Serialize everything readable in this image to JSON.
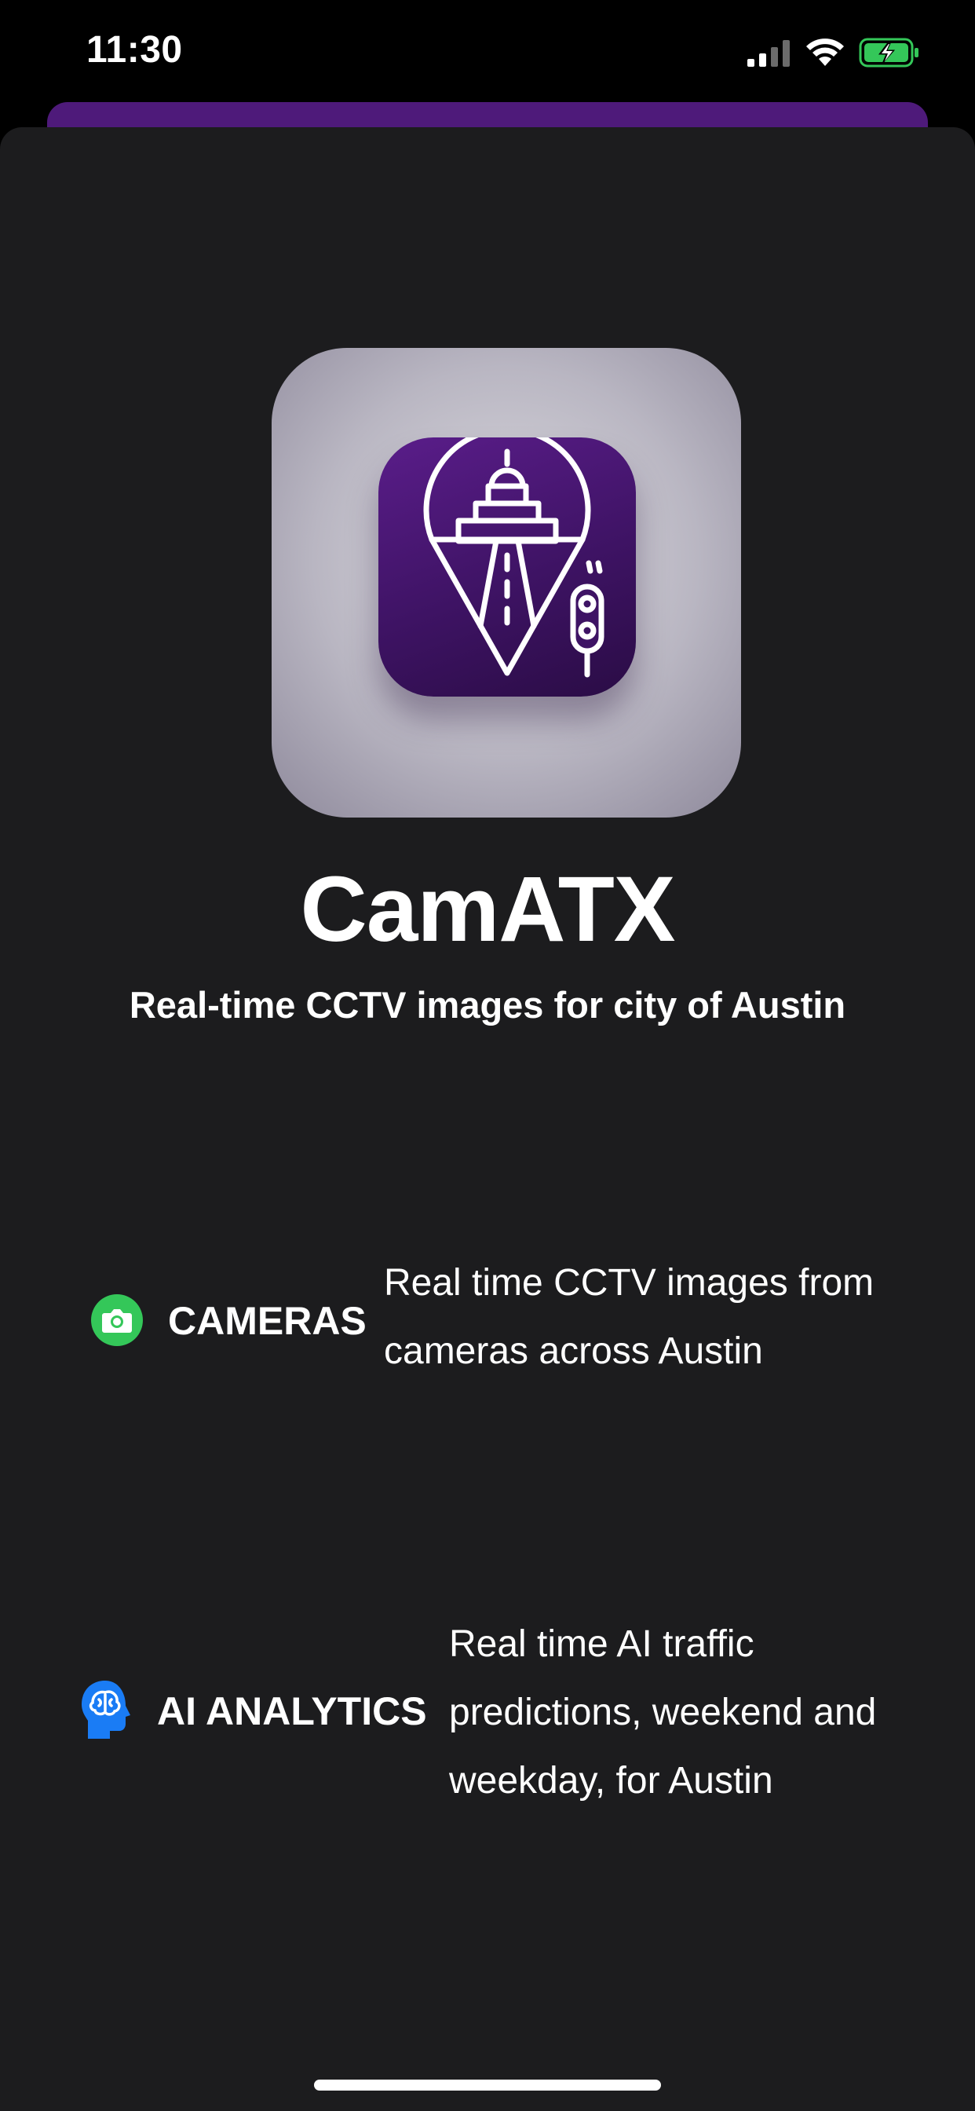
{
  "status_bar": {
    "time": "11:30",
    "icons": [
      "signal-icon",
      "wifi-icon",
      "battery-charging-icon"
    ],
    "battery_color": "#34c759"
  },
  "app": {
    "name": "CamATX",
    "tagline": "Real-time CCTV images for city of Austin",
    "icon": "camatx-app-icon"
  },
  "features": [
    {
      "icon": "camera-icon",
      "icon_color": "#34c759",
      "label": "CAMERAS",
      "description_lines": [
        "Real time CCTV images from",
        "cameras across Austin"
      ]
    },
    {
      "icon": "brain-head-icon",
      "icon_color": "#1a7cf5",
      "label": "AI ANALYTICS",
      "description_lines": [
        "Real time AI traffic",
        "predictions, weekend and",
        "weekday, for Austin"
      ]
    }
  ],
  "colors": {
    "background": "#1c1c1e",
    "accent_purple": "#4e1a7a"
  }
}
